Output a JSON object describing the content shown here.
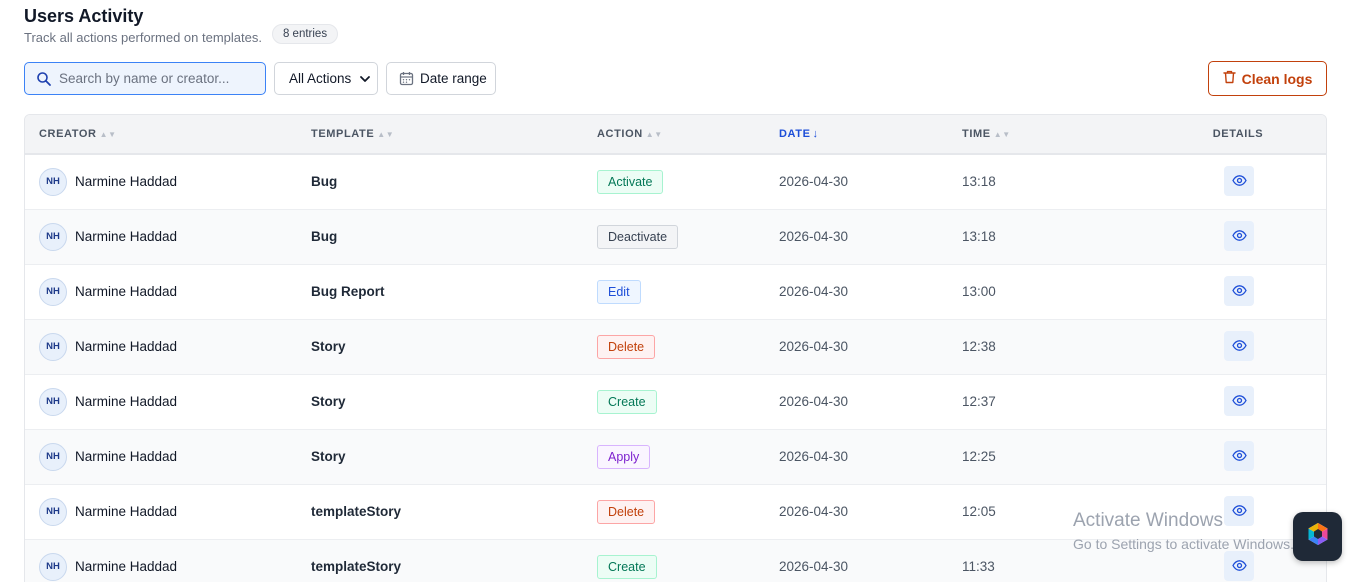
{
  "header": {
    "title": "Users Activity",
    "subtitle": "Track all actions performed on templates.",
    "entries_badge": "8 entries"
  },
  "toolbar": {
    "search_placeholder": "Search by name or creator...",
    "search_value": "",
    "action_filter": "All Actions",
    "date_range_label": "Date range",
    "clean_logs_label": "Clean logs"
  },
  "table": {
    "columns": {
      "creator": "CREATOR",
      "template": "TEMPLATE",
      "action": "ACTION",
      "date": "DATE",
      "time": "TIME",
      "details": "DETAILS"
    },
    "sort": {
      "column": "date",
      "direction": "desc"
    },
    "rows": [
      {
        "initials": "NH",
        "creator": "Narmine Haddad",
        "template": "Bug",
        "action": "Activate",
        "date": "2026-04-30",
        "time": "13:18"
      },
      {
        "initials": "NH",
        "creator": "Narmine Haddad",
        "template": "Bug",
        "action": "Deactivate",
        "date": "2026-04-30",
        "time": "13:18"
      },
      {
        "initials": "NH",
        "creator": "Narmine Haddad",
        "template": "Bug Report",
        "action": "Edit",
        "date": "2026-04-30",
        "time": "13:00"
      },
      {
        "initials": "NH",
        "creator": "Narmine Haddad",
        "template": "Story",
        "action": "Delete",
        "date": "2026-04-30",
        "time": "12:38"
      },
      {
        "initials": "NH",
        "creator": "Narmine Haddad",
        "template": "Story",
        "action": "Create",
        "date": "2026-04-30",
        "time": "12:37"
      },
      {
        "initials": "NH",
        "creator": "Narmine Haddad",
        "template": "Story",
        "action": "Apply",
        "date": "2026-04-30",
        "time": "12:25"
      },
      {
        "initials": "NH",
        "creator": "Narmine Haddad",
        "template": "templateStory",
        "action": "Delete",
        "date": "2026-04-30",
        "time": "12:05"
      },
      {
        "initials": "NH",
        "creator": "Narmine Haddad",
        "template": "templateStory",
        "action": "Create",
        "date": "2026-04-30",
        "time": "11:33"
      }
    ]
  },
  "action_styles": {
    "Activate": "p-activate",
    "Deactivate": "p-deactivate",
    "Edit": "p-edit",
    "Delete": "p-delete",
    "Create": "p-create",
    "Apply": "p-apply"
  },
  "icons": {
    "search": "search-icon",
    "calendar": "calendar-icon",
    "trash": "trash-icon",
    "eye": "eye-icon",
    "chevron": "chevron-down-icon"
  },
  "colors": {
    "accent": "#1d4ed8",
    "danger": "#c2410c"
  },
  "watermark": {
    "title": "Activate Windows",
    "subtitle": "Go to Settings to activate Windows."
  }
}
